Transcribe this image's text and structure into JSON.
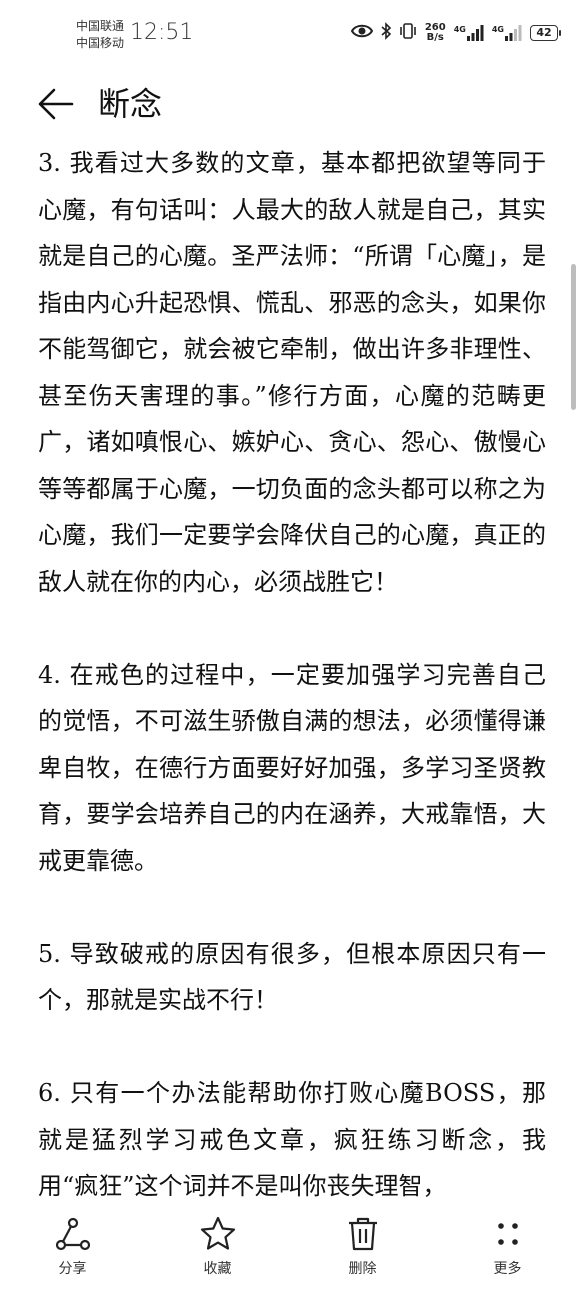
{
  "status_bar": {
    "carrier_1": "中国联通",
    "carrier_2": "中国移动",
    "time": "12:51",
    "net_speed_value": "260",
    "net_speed_unit": "B/s",
    "signal_1_label": "4G",
    "signal_2_label": "4G",
    "battery": "42"
  },
  "header": {
    "title": "断念"
  },
  "article": {
    "paragraphs": [
      "3. 我看过大多数的文章，基本都把欲望等同于心魔，有句话叫：人最大的敌人就是自己，其实就是自己的心魔。圣严法师：“所谓「心魔」，是指由内心升起恐惧、慌乱、邪恶的念头，如果你不能驾御它，就会被它牵制，做出许多非理性、甚至伤天害理的事。”修行方面，心魔的范畴更广，诸如嗔恨心、嫉妒心、贪心、怨心、傲慢心等等都属于心魔，一切负面的念头都可以称之为心魔，我们一定要学会降伏自己的心魔，真正的敌人就在你的内心，必须战胜它！",
      "4. 在戒色的过程中，一定要加强学习完善自己的觉悟，不可滋生骄傲自满的想法，必须懂得谦卑自牧，在德行方面要好好加强，多学习圣贤教育，要学会培养自己的内在涵养，大戒靠悟，大戒更靠德。",
      "5. 导致破戒的原因有很多，但根本原因只有一个，那就是实战不行！",
      "6. 只有一个办法能帮助你打败心魔BOSS，那就是猛烈学习戒色文章，疯狂练习断念，我用“疯狂”这个词并不是叫你丧失理智，"
    ]
  },
  "toolbar": {
    "share": "分享",
    "favorite": "收藏",
    "delete": "删除",
    "more": "更多"
  }
}
